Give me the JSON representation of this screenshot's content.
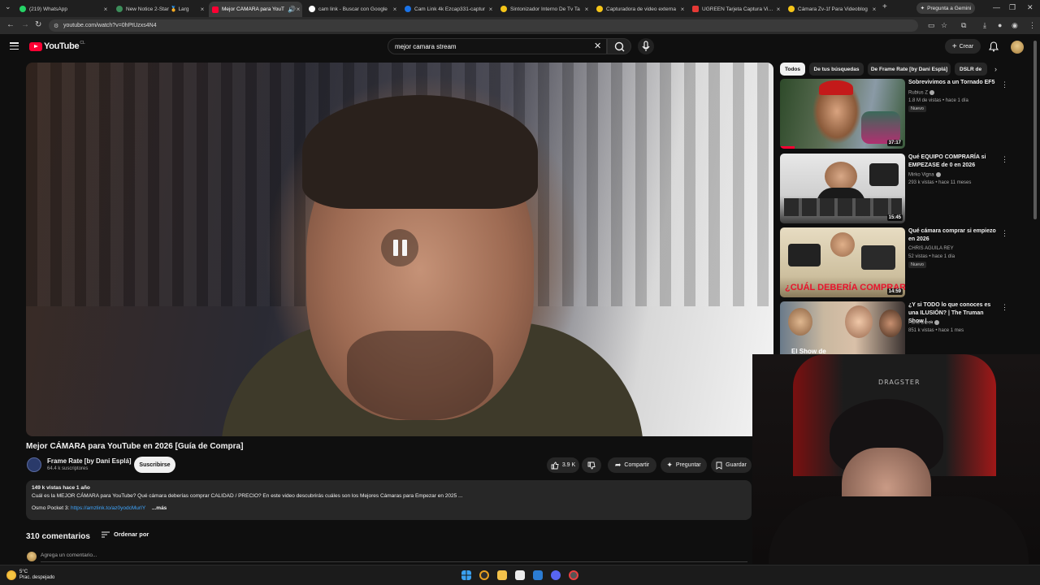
{
  "browser": {
    "tabs": [
      {
        "label": "(219) WhatsApp",
        "color": "#25d366"
      },
      {
        "label": "New Notice 2-Star 🏅 Larg",
        "color": "#3c8d5a"
      },
      {
        "label": "Mejor CÁMARA para YouT",
        "color": "#ff0033",
        "active": true
      },
      {
        "label": "cam link - Buscar con Google",
        "color": "#ffffff"
      },
      {
        "label": "Cam Link 4k Ezcap331-captur",
        "color": "#1a73e8"
      },
      {
        "label": "Sintonizador Interno De Tv Ta",
        "color": "#f5c518"
      },
      {
        "label": "Capturadora de video externa",
        "color": "#f5c518"
      },
      {
        "label": "UGREEN Tarjeta Captura Video",
        "color": "#e53935"
      },
      {
        "label": "Cámara Zv-1f Para Videoblog",
        "color": "#f5c518"
      }
    ],
    "gemini_label": "Pregunta a Gemini",
    "url": "youtube.com/watch?v=0hPtUzxs4N4"
  },
  "header": {
    "logo_text": "YouTube",
    "region": "CL",
    "search_value": "mejor camara stream",
    "create_label": "Crear"
  },
  "video": {
    "title": "Mejor CÁMARA para YouTube en 2026 [Guía de Compra]",
    "channel": "Frame Rate [by Dani Esplá]",
    "subscribers": "64.4 k suscriptores",
    "subscribe_label": "Suscribirse",
    "likes": "3.9 K",
    "share_label": "Compartir",
    "ask_label": "Preguntar",
    "save_label": "Guardar",
    "description": {
      "meta": "149 k vistas  hace 1 año",
      "line1": "Cuál es la MEJOR CÁMARA para YouTube? Qué cámara deberías comprar CALIDAD / PRECIO? En este video descubrirás cuáles son los Mejores Cámaras para Empezar en 2025 ...",
      "line2_prefix": "Osmo Pocket 3: ",
      "link": "https://amzlink.to/az0yodcMurIY",
      "more": "...más"
    }
  },
  "comments": {
    "count": "310 comentarios",
    "sort_label": "Ordenar por",
    "placeholder": "Agrega un comentario..."
  },
  "sidebar": {
    "chips": [
      "Todos",
      "De tus búsquedas",
      "De Frame Rate [by Dani Esplá]",
      "DSLR de"
    ],
    "recommendations": [
      {
        "title": "Sobrevivimos a un Tornado EF5",
        "channel": "Rubius Z",
        "meta": "1.8 M de vistas • hace 1 día",
        "badge": "Nuevo",
        "duration": "37:17",
        "progress": 0.12
      },
      {
        "title": "Qué EQUIPO COMPRARÍA si EMPEZASE de 0 en 2026",
        "channel": "Mirko Vigna",
        "meta": "293 k vistas • hace 11 meses",
        "badge": "",
        "duration": "15:45"
      },
      {
        "title": "Qué cámara comprar si empiezo en 2026",
        "channel": "CHRIS AGUILA REY",
        "meta": "52 vistas • hace 1 día",
        "badge": "Nuevo",
        "duration": "14:59",
        "thumb_caption": "¿CUÁL DEBERÍA COMPRAR?"
      },
      {
        "title": "¿Y si TODO lo que conoces es una ILUSIÓN? | The Truman Show | ...",
        "channel": "Farid Dieck",
        "meta": "851 k vistas • hace 1 mes",
        "badge": "",
        "duration": "",
        "thumb_caption": "El Show de"
      }
    ]
  },
  "webcam": {
    "chair_brand": "DRAGSTER"
  },
  "taskbar": {
    "temperature": "5°C",
    "weather": "Prac. despejado"
  }
}
